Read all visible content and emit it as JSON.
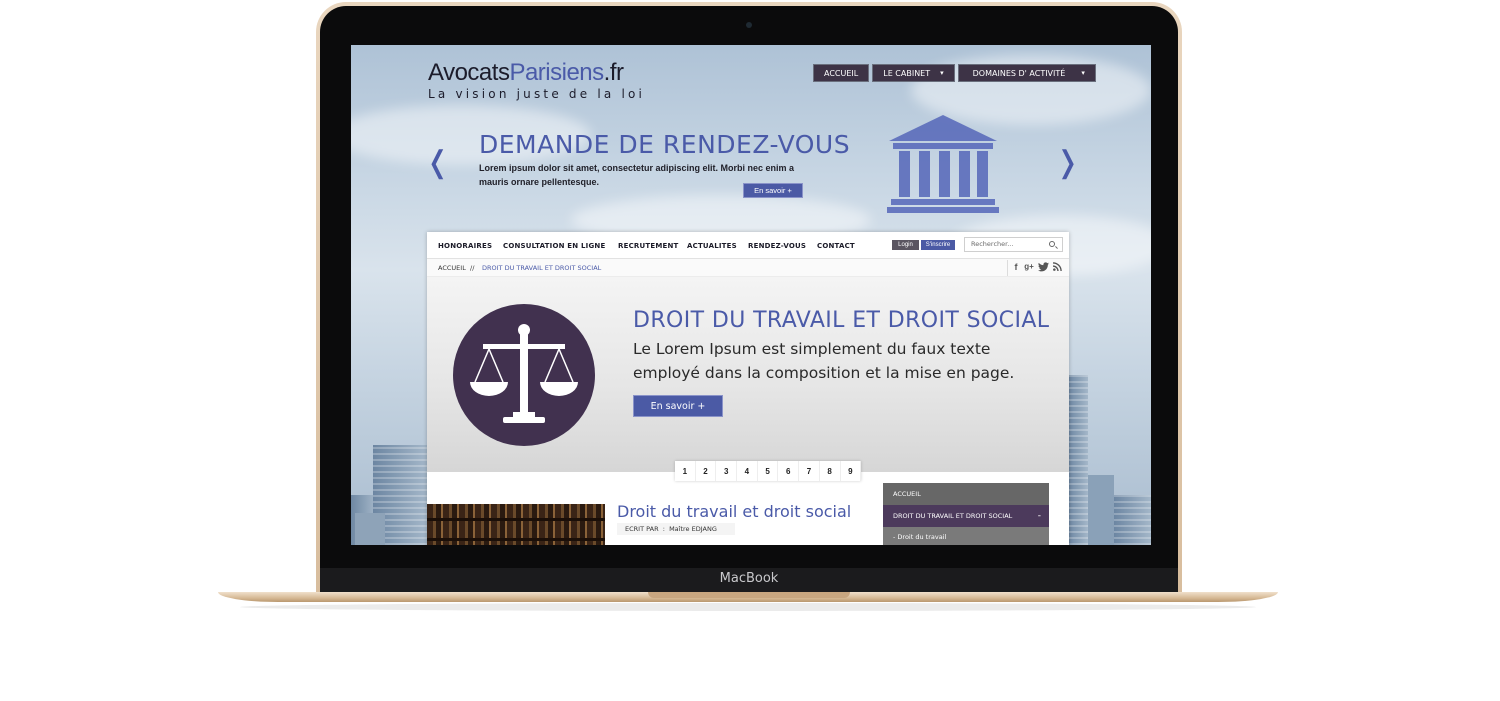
{
  "device": {
    "brand": "MacBook"
  },
  "site": {
    "logo_main": "Avocats",
    "logo_accent": "Parisiens",
    "logo_tld": ".fr",
    "tagline": "La vision juste de la loi"
  },
  "top_nav": [
    {
      "label": "ACCUEIL",
      "dropdown": false
    },
    {
      "label": "LE CABINET",
      "dropdown": true
    },
    {
      "label": "DOMAINES D' ACTIVITÉ",
      "dropdown": true
    }
  ],
  "hero": {
    "title": "DEMANDE DE RENDEZ-VOUS",
    "text": "Lorem ipsum dolor sit amet, consectetur adipiscing elit. Morbi nec enim a mauris ornare pellentesque.",
    "button": "En savoir +",
    "prev_arrow": "❬",
    "next_arrow": "❭"
  },
  "sub_nav": [
    "HONORAIRES",
    "CONSULTATION EN LIGNE",
    "RECRUTEMENT",
    "ACTUALITES",
    "RENDEZ-VOUS",
    "CONTACT"
  ],
  "auth": {
    "login": "Login",
    "signup": "S'inscrire"
  },
  "search": {
    "placeholder": "Rechercher..."
  },
  "breadcrumb": {
    "home": "ACCUEIL",
    "separator": "//",
    "current": "DROIT DU TRAVAIL ET DROIT SOCIAL"
  },
  "social": {
    "facebook": "f",
    "google": "g+",
    "twitter": "t",
    "rss": "≈"
  },
  "feature": {
    "title": "DROIT DU TRAVAIL ET DROIT SOCIAL",
    "text": "Le Lorem Ipsum est simplement du faux texte employé dans la composition et la mise en page.",
    "button": "En savoir +"
  },
  "pagination": [
    "1",
    "2",
    "3",
    "4",
    "5",
    "6",
    "7",
    "8",
    "9"
  ],
  "article": {
    "title": "Droit du travail et droit social",
    "meta_label": "ECRIT PAR",
    "meta_sep": ":",
    "meta_author": "Maître EDJANG"
  },
  "side_menu": {
    "items": [
      {
        "label": "ACCUEIL"
      },
      {
        "label": "DROIT DU TRAVAIL ET DROIT SOCIAL",
        "expanded_mark": "-"
      },
      {
        "label": "- Droit du travail"
      }
    ]
  },
  "colors": {
    "accent": "#4a5aa8",
    "dark_purple": "#41314f",
    "nav_dark": "#3d3346"
  }
}
